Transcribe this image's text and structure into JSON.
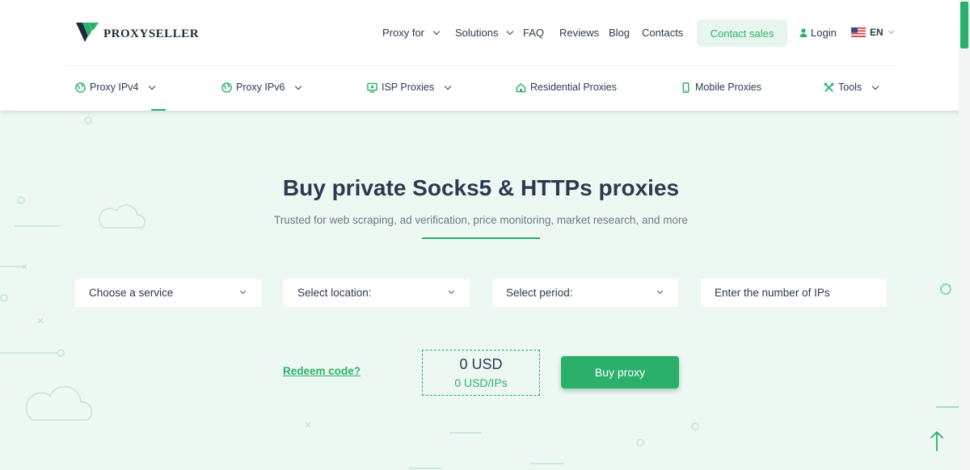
{
  "brand": {
    "name": "PROXYSELLER"
  },
  "nav": {
    "items": [
      {
        "label": "Proxy for",
        "has_dropdown": true
      },
      {
        "label": "Solutions",
        "has_dropdown": true
      },
      {
        "label": "FAQ"
      },
      {
        "label": "Reviews"
      },
      {
        "label": "Blog"
      },
      {
        "label": "Contacts"
      }
    ],
    "contact_label": "Contact sales",
    "login_label": "Login",
    "language": "EN"
  },
  "categories": [
    {
      "label": "Proxy IPv4",
      "icon": "globe-icon",
      "has_dropdown": true
    },
    {
      "label": "Proxy IPv6",
      "icon": "globe-icon",
      "has_dropdown": true
    },
    {
      "label": "ISP Proxies",
      "icon": "monitor-icon",
      "has_dropdown": true
    },
    {
      "label": "Residential Proxies",
      "icon": "home-icon"
    },
    {
      "label": "Mobile Proxies",
      "icon": "phone-icon"
    },
    {
      "label": "Tools",
      "icon": "tools-icon",
      "has_dropdown": true
    }
  ],
  "hero": {
    "title": "Buy private Socks5 & HTTPs proxies",
    "subtitle": "Trusted for web scraping, ad verification, price monitoring, market research, and more"
  },
  "form": {
    "service": "Choose a service",
    "location": "Select location:",
    "period": "Select period:",
    "ips_placeholder": "Enter the number of IPs",
    "redeem_label": "Redeem code?",
    "price_total": "0 USD",
    "price_per": "0 USD/IPs",
    "buy_label": "Buy proxy"
  },
  "colors": {
    "accent": "#2ab06a",
    "background": "#eef8f2",
    "text": "#2b3a4e"
  }
}
